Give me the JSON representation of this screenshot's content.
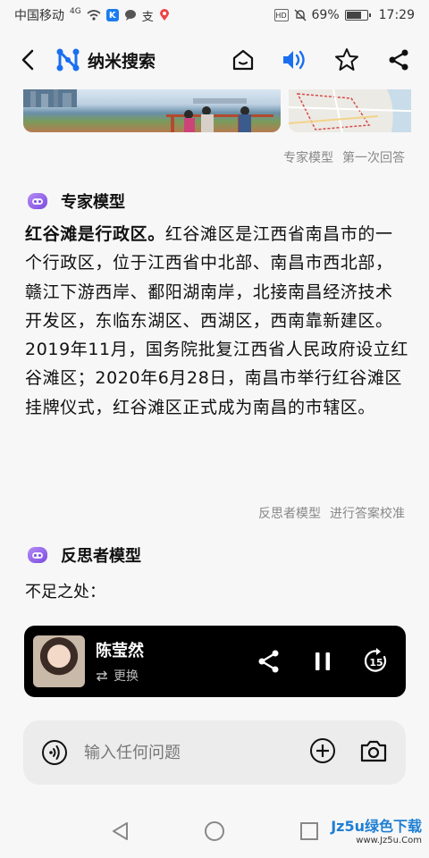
{
  "status_bar": {
    "carrier": "中国移动",
    "network": "4G",
    "battery": "69%",
    "battery_level": 0.69,
    "time": "17:29",
    "hd_label": "HD"
  },
  "header": {
    "app_title": "纳米搜索",
    "icons": [
      "back-icon",
      "nano-logo-icon",
      "home-icon",
      "speaker-icon",
      "star-icon",
      "share-icon"
    ],
    "accent_color": "#1a6ff0"
  },
  "expert_section": {
    "meta": [
      "专家模型",
      "第一次回答"
    ],
    "title": "专家模型",
    "answer_lead": "红谷滩是行政区。",
    "answer_body": "红谷滩区是江西省南昌市的一个行政区，位于江西省中北部、南昌市西北部，赣江下游西岸、鄱阳湖南岸，北接南昌经济技术开发区，东临东湖区、西湖区，西南靠新建区。2019年11月，国务院批复江西省人民政府设立红谷滩区；2020年6月28日，南昌市举行红谷滩区挂牌仪式，红谷滩区正式成为南昌的市辖区。"
  },
  "reflect_section": {
    "meta": [
      "反思者模型",
      "进行答案校准"
    ],
    "title": "反思者模型",
    "shortfall": "不足之处："
  },
  "player": {
    "name": "陈莹然",
    "switch_label": "更换",
    "icons": [
      "share-icon",
      "pause-icon",
      "replay-15-icon"
    ],
    "replay_seconds": "15"
  },
  "input": {
    "placeholder": "输入任何问题",
    "icons": [
      "voice-icon",
      "add-icon",
      "camera-icon"
    ]
  },
  "watermark": {
    "line1": "Jz5u绿色下载",
    "line2": "www.Jz5u.Com"
  }
}
